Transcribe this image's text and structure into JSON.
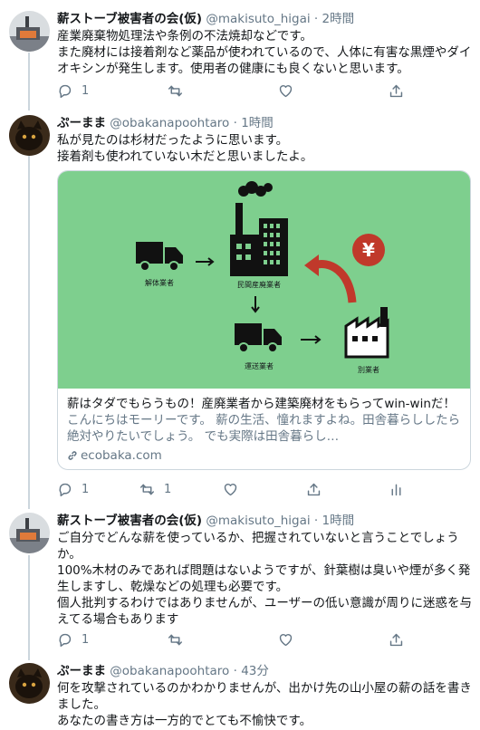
{
  "tweets": [
    {
      "name": "薪ストーブ被害者の会(仮)",
      "handle": "@makisuto_higai",
      "sep": "·",
      "time": "2時間",
      "text": "産業廃棄物処理法や条例の不法焼却などです。\nまた廃材には接着剤など薬品が使われているので、人体に有害な黒煙やダイオキシンが発生します。使用者の健康にも良くないと思います。",
      "reply_count": "1",
      "retweet_count": "",
      "like_count": ""
    },
    {
      "name": "ぷーまま",
      "handle": "@obakanapoohtaro",
      "sep": "·",
      "time": "1時間",
      "text": "私が見たのは杉材だったように思います。\n接着剤も使われていない木だと思いましたよ。",
      "reply_count": "1",
      "retweet_count": "1",
      "like_count": "",
      "card": {
        "title": "薪はタダでもらうもの！産廃業者から建築廃材をもらってwin-winだ！",
        "description": "こんにちはモーリーです。 薪の生活、憧れますよね。田舎暮らししたら絶対やりたいでしょう。 でも実際は田舎暮らし…",
        "domain": "ecobaka.com",
        "image_labels": {
          "dismantler": "解体業者",
          "private_processor": "民間産廃業者",
          "transporter": "運送業者",
          "other_business": "別業者",
          "yen_symbol": "¥"
        },
        "image_bg_color": "#7ecf8e"
      }
    },
    {
      "name": "薪ストーブ被害者の会(仮)",
      "handle": "@makisuto_higai",
      "sep": "·",
      "time": "1時間",
      "text": "ご自分でどんな薪を使っているか、把握されていないと言うことでしょうか。\n100%木材のみであれば問題はないようですが、針葉樹は臭いや煙が多く発生しますし、乾燥などの処理も必要です。\n個人批判するわけではありませんが、ユーザーの低い意識が周りに迷惑を与えてる場合もあります",
      "reply_count": "1",
      "retweet_count": "",
      "like_count": ""
    },
    {
      "name": "ぷーまま",
      "handle": "@obakanapoohtaro",
      "sep": "·",
      "time": "43分",
      "text": "何を攻撃されているのかわかりませんが、出かけ先の山小屋の薪の話を書きました。\nあなたの書き方は一方的でとても不愉快です。"
    }
  ],
  "colors": {
    "text_primary": "#14171a",
    "text_secondary": "#657786",
    "border": "#ccd6dd",
    "thread_line": "#ccd6dd",
    "yen_red": "#c0392b"
  }
}
